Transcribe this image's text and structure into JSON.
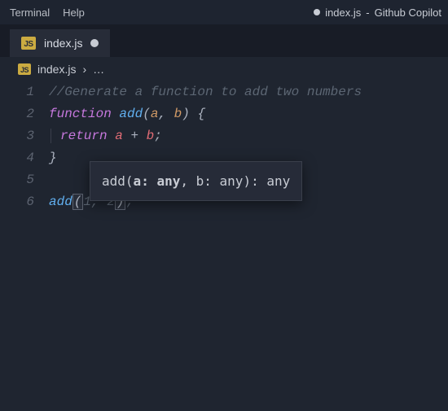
{
  "menubar": {
    "terminal": "Terminal",
    "help": "Help",
    "title_file": "index.js",
    "title_app": "Github Copilot"
  },
  "tab": {
    "filename": "index.js"
  },
  "breadcrumb": {
    "filename": "index.js"
  },
  "editor": {
    "lines": {
      "l1": "1",
      "l2": "2",
      "l3": "3",
      "l4": "4",
      "l5": "5",
      "l6": "6"
    },
    "comment": "//Generate a function to add two numbers",
    "kw_function": "function",
    "fn_name": "add",
    "p1": "a",
    "p2": "b",
    "kw_return": "return",
    "var_a": "a",
    "op_plus": "+",
    "var_b": "b",
    "call_fn": "add",
    "ghost_arg1": "1",
    "ghost_arg2": "2"
  },
  "tooltip": {
    "fn": "add",
    "p1": "a",
    "t1": "any",
    "p2": "b",
    "t2": "any",
    "ret": "any"
  }
}
